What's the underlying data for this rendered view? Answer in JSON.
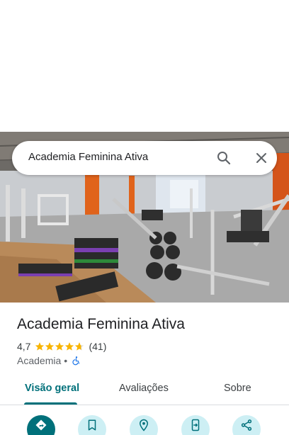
{
  "search": {
    "query": "Academia Feminina Ativa"
  },
  "place": {
    "name": "Academia Feminina Ativa",
    "rating": "4,7",
    "stars": 4.7,
    "review_count": "(41)",
    "category": "Academia",
    "separator": "•"
  },
  "tabs": [
    {
      "label": "Visão geral",
      "active": true
    },
    {
      "label": "Avaliações",
      "active": false
    },
    {
      "label": "Sobre",
      "active": false
    }
  ],
  "actions": [
    {
      "icon": "directions-icon"
    },
    {
      "icon": "bookmark-icon"
    },
    {
      "icon": "nearby-pin-icon"
    },
    {
      "icon": "send-to-phone-icon"
    },
    {
      "icon": "share-icon"
    }
  ],
  "colors": {
    "accent": "#00707a",
    "accent_light": "#cdeff4",
    "star": "#f8b400",
    "access_blue": "#1a73e8"
  }
}
